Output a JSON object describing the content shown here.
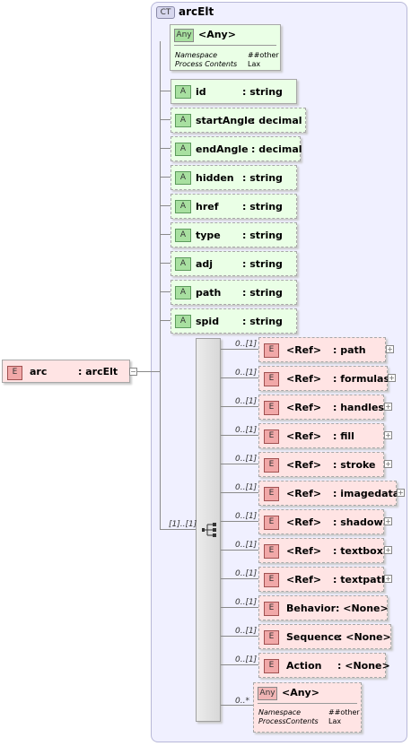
{
  "complex_type": {
    "badge": "CT",
    "name": "arcElt"
  },
  "root_element": {
    "badge": "E",
    "name": "arc",
    "type": ": arcElt",
    "expander": "−"
  },
  "any_attribute": {
    "badge": "Any",
    "title": "<Any>",
    "namespace_key": "Namespace",
    "namespace_value": "##other",
    "process_key": "Process Contents",
    "process_value": "Lax"
  },
  "attributes": [
    {
      "badge": "A",
      "name": "id",
      "type": ": string"
    },
    {
      "badge": "A",
      "name": "startAngle",
      "type": ": decimal"
    },
    {
      "badge": "A",
      "name": "endAngle",
      "type": ": decimal"
    },
    {
      "badge": "A",
      "name": "hidden",
      "type": ": string"
    },
    {
      "badge": "A",
      "name": "href",
      "type": ": string"
    },
    {
      "badge": "A",
      "name": "type",
      "type": ": string"
    },
    {
      "badge": "A",
      "name": "adj",
      "type": ": string"
    },
    {
      "badge": "A",
      "name": "path",
      "type": ": string"
    },
    {
      "badge": "A",
      "name": "spid",
      "type": ": string"
    }
  ],
  "sequence": {
    "occurrence": "[1]..[1]",
    "icon": "sequence-icon"
  },
  "children": [
    {
      "occ": "0..[1]",
      "badge": "E",
      "name": "<Ref>",
      "type": ": path",
      "plus": "+"
    },
    {
      "occ": "0..[1]",
      "badge": "E",
      "name": "<Ref>",
      "type": ": formulas",
      "plus": "+"
    },
    {
      "occ": "0..[1]",
      "badge": "E",
      "name": "<Ref>",
      "type": ": handles",
      "plus": "+"
    },
    {
      "occ": "0..[1]",
      "badge": "E",
      "name": "<Ref>",
      "type": ": fill",
      "plus": "+"
    },
    {
      "occ": "0..[1]",
      "badge": "E",
      "name": "<Ref>",
      "type": ": stroke",
      "plus": "+"
    },
    {
      "occ": "0..[1]",
      "badge": "E",
      "name": "<Ref>",
      "type": ": imagedata",
      "plus": "+"
    },
    {
      "occ": "0..[1]",
      "badge": "E",
      "name": "<Ref>",
      "type": ": shadow",
      "plus": "+"
    },
    {
      "occ": "0..[1]",
      "badge": "E",
      "name": "<Ref>",
      "type": ": textbox",
      "plus": "+"
    },
    {
      "occ": "0..[1]",
      "badge": "E",
      "name": "<Ref>",
      "type": ": textpath",
      "plus": "+"
    },
    {
      "occ": "0..[1]",
      "badge": "E",
      "name": "Behavior",
      "type": ": <None>"
    },
    {
      "occ": "0..[1]",
      "badge": "E",
      "name": "Sequence",
      "type": ": <None>"
    },
    {
      "occ": "0..[1]",
      "badge": "E",
      "name": "Action",
      "type": ": <None>"
    }
  ],
  "any_element": {
    "occ": "0..*",
    "badge": "Any",
    "title": "<Any>",
    "namespace_key": "Namespace",
    "namespace_value": "##other",
    "process_key": "ProcessContents",
    "process_value": "Lax"
  }
}
